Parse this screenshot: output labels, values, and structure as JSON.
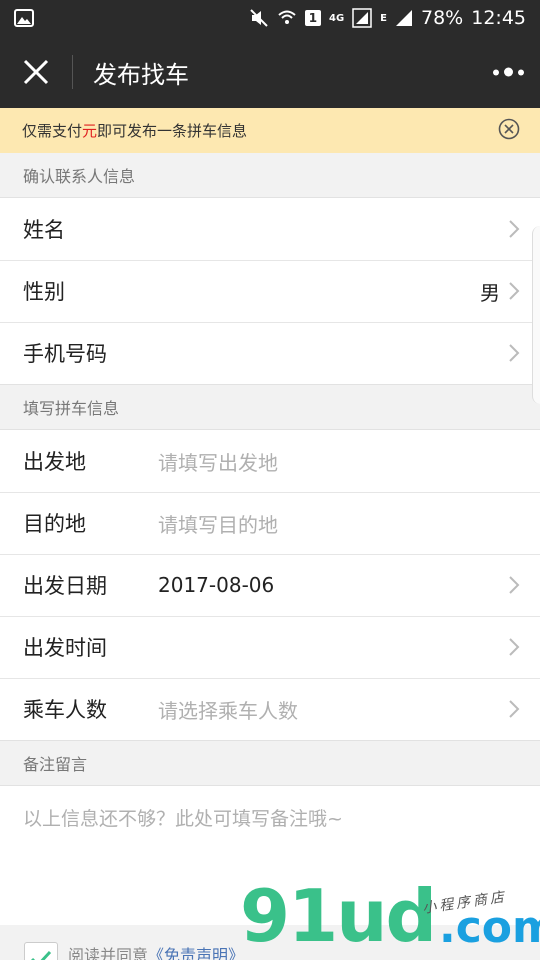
{
  "status_bar": {
    "network": "4G",
    "sim": "1",
    "data_type": "E",
    "battery": "78%",
    "time": "12:45"
  },
  "nav": {
    "title": "发布找车"
  },
  "notice": {
    "text_before": "仅需支付",
    "text_highlight": "元",
    "text_after": "即可发布一条拼车信息"
  },
  "contact_section": {
    "header": "确认联系人信息",
    "rows": [
      {
        "label": "姓名",
        "value": ""
      },
      {
        "label": "性别",
        "value": "男"
      },
      {
        "label": "手机号码",
        "value": ""
      }
    ]
  },
  "carpool_section": {
    "header": "填写拼车信息",
    "departure": {
      "label": "出发地",
      "placeholder": "请填写出发地"
    },
    "destination": {
      "label": "目的地",
      "placeholder": "请填写目的地"
    },
    "date": {
      "label": "出发日期",
      "value": "2017-08-06"
    },
    "time": {
      "label": "出发时间",
      "value": ""
    },
    "passengers": {
      "label": "乘车人数",
      "placeholder": "请选择乘车人数"
    }
  },
  "remark_section": {
    "header": "备注留言",
    "placeholder": "以上信息还不够？此处可填写备注哦~"
  },
  "agreement": {
    "text": "阅读并同意",
    "link": "《免责声明》"
  },
  "watermark": {
    "brand": "91ud",
    "tld": ".com",
    "tagline": "小程序商店"
  },
  "colors": {
    "nav_bg": "#2b2b2b",
    "notice_bg": "#fde8b1",
    "highlight_red": "#e02020",
    "placeholder_gray": "#b0b0b0",
    "link_blue": "#4a74b5"
  }
}
